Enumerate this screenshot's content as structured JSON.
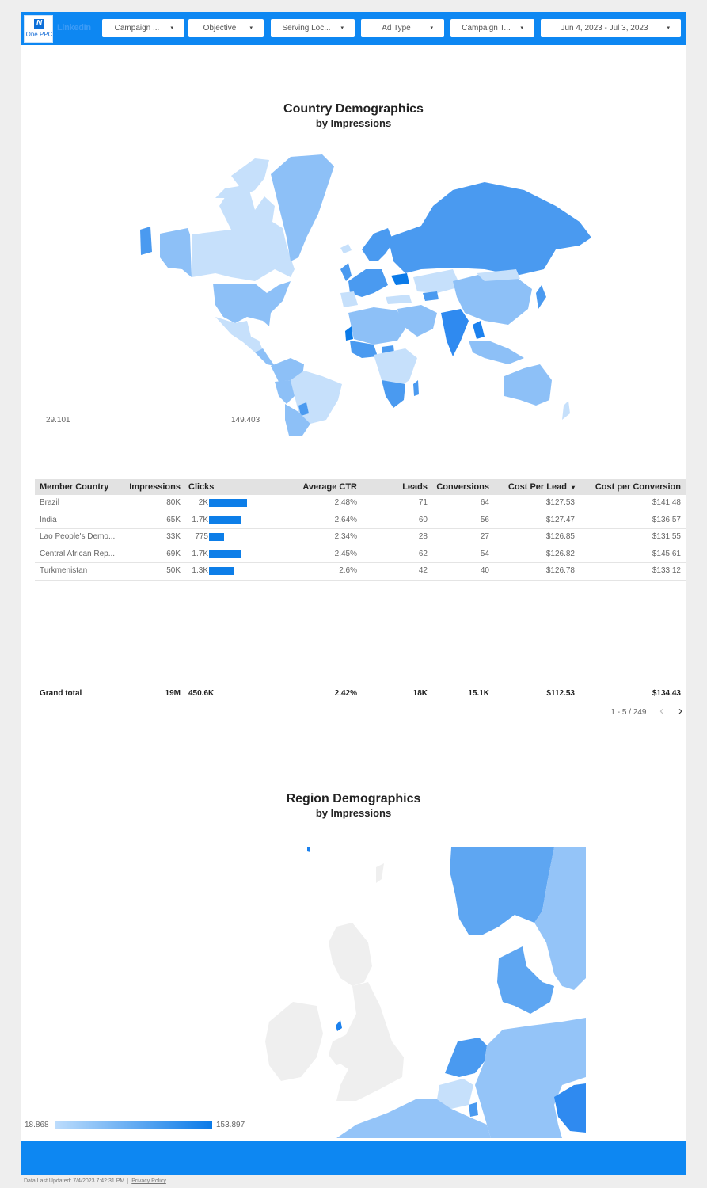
{
  "header": {
    "logo_text": "One PPC",
    "logo_glyph": "N",
    "secondary_logo": "LinkedIn",
    "filters": [
      {
        "label": "Campaign ..."
      },
      {
        "label": "Objective"
      },
      {
        "label": "Serving Loc..."
      },
      {
        "label": "Ad Type"
      },
      {
        "label": "Campaign T..."
      },
      {
        "label": "Jun 4, 2023 - Jul 3, 2023"
      }
    ],
    "caret": "▾"
  },
  "country_map": {
    "title": "Country Demographics",
    "subtitle": "by Impressions",
    "legend_min": "29.101",
    "legend_max": "149.403",
    "colors": {
      "low": "#c6e0fb",
      "mid": "#8dc0f7",
      "high": "#4a9af0",
      "max": "#0a7ae8"
    }
  },
  "table": {
    "headers": [
      "Member Country",
      "Impressions",
      "Clicks",
      "Average CTR",
      "Leads",
      "Conversions",
      "Cost Per Lead",
      "Cost per Conversion"
    ],
    "sort_indicator": "▾",
    "rows": [
      {
        "country": "Brazil",
        "impressions": "80K",
        "clicks": "2K",
        "clicks_value": 2000,
        "ctr": "2.48%",
        "leads": "71",
        "conversions": "64",
        "cpl": "$127.53",
        "cpc": "$141.48"
      },
      {
        "country": "India",
        "impressions": "65K",
        "clicks": "1.7K",
        "clicks_value": 1700,
        "ctr": "2.64%",
        "leads": "60",
        "conversions": "56",
        "cpl": "$127.47",
        "cpc": "$136.57"
      },
      {
        "country": "Lao People's Demo...",
        "impressions": "33K",
        "clicks": "775",
        "clicks_value": 775,
        "ctr": "2.34%",
        "leads": "28",
        "conversions": "27",
        "cpl": "$126.85",
        "cpc": "$131.55"
      },
      {
        "country": "Central African Rep...",
        "impressions": "69K",
        "clicks": "1.7K",
        "clicks_value": 1650,
        "ctr": "2.45%",
        "leads": "62",
        "conversions": "54",
        "cpl": "$126.82",
        "cpc": "$145.61"
      },
      {
        "country": "Turkmenistan",
        "impressions": "50K",
        "clicks": "1.3K",
        "clicks_value": 1300,
        "ctr": "2.6%",
        "leads": "42",
        "conversions": "40",
        "cpl": "$126.78",
        "cpc": "$133.12"
      }
    ],
    "clicks_max": 2000,
    "grand_total": {
      "label": "Grand total",
      "impressions": "19M",
      "clicks": "450.6K",
      "ctr": "2.42%",
      "leads": "18K",
      "conversions": "15.1K",
      "cpl": "$112.53",
      "cpc": "$134.43"
    },
    "pagination": {
      "text": "1 - 5 / 249",
      "prev": "‹",
      "next": "›"
    },
    "bar_color": "#0d7ee8"
  },
  "region_map": {
    "title": "Region Demographics",
    "subtitle": "by Impressions",
    "legend_min": "18.868",
    "legend_max": "153.897",
    "no_data_color": "#efefef"
  },
  "footer": {
    "last_updated": "Data Last Updated: 7/4/2023 7:42:31 PM",
    "privacy": "Privacy Policy"
  },
  "brand_color": "#0d87f2"
}
